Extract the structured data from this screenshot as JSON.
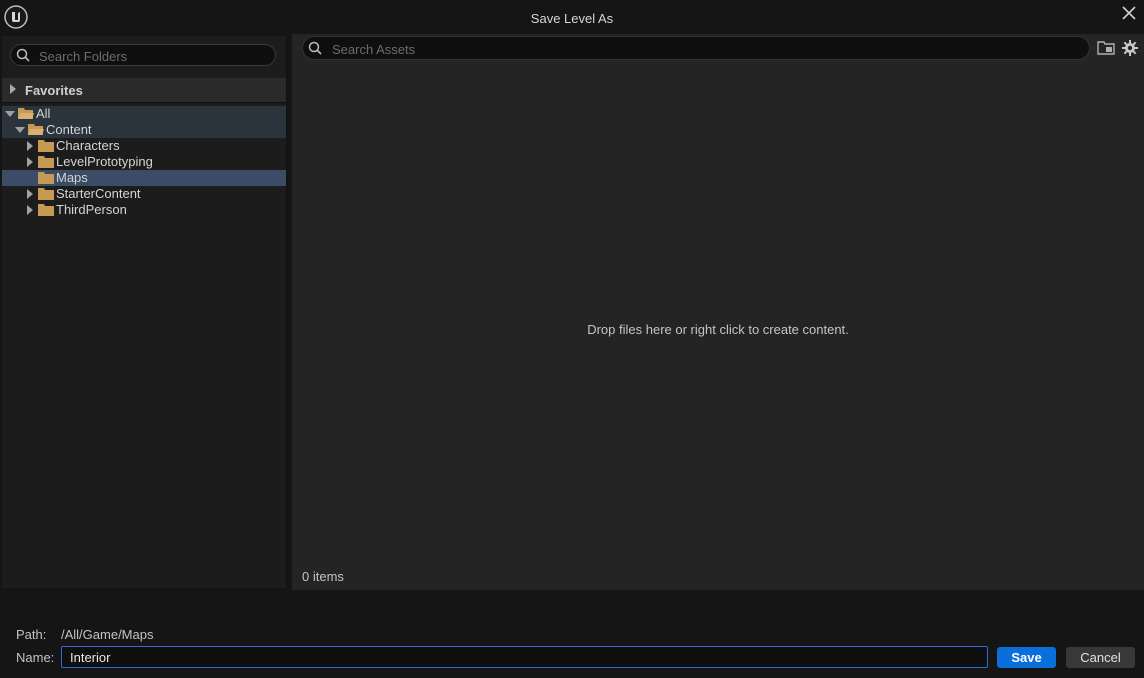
{
  "window": {
    "title": "Save Level As"
  },
  "left_panel": {
    "search_placeholder": "Search Folders",
    "favorites_label": "Favorites",
    "tree": {
      "all": "All",
      "content": "Content",
      "items": [
        {
          "label": "Characters",
          "expandable": true,
          "selected": false
        },
        {
          "label": "LevelPrototyping",
          "expandable": true,
          "selected": false
        },
        {
          "label": "Maps",
          "expandable": false,
          "selected": true
        },
        {
          "label": "StarterContent",
          "expandable": true,
          "selected": false
        },
        {
          "label": "ThirdPerson",
          "expandable": true,
          "selected": false
        }
      ]
    }
  },
  "right_panel": {
    "search_placeholder": "Search Assets",
    "drop_hint": "Drop files here or right click to create content.",
    "item_count": "0 items"
  },
  "footer": {
    "path_label": "Path:",
    "path_value": "/All/Game/Maps",
    "name_label": "Name:",
    "name_value": "Interior",
    "save_label": "Save",
    "cancel_label": "Cancel"
  },
  "colors": {
    "background": "#151515",
    "panel": "#242424",
    "selection": "#3b4c66",
    "accent": "#0a6edb",
    "folder": "#c59a55"
  }
}
